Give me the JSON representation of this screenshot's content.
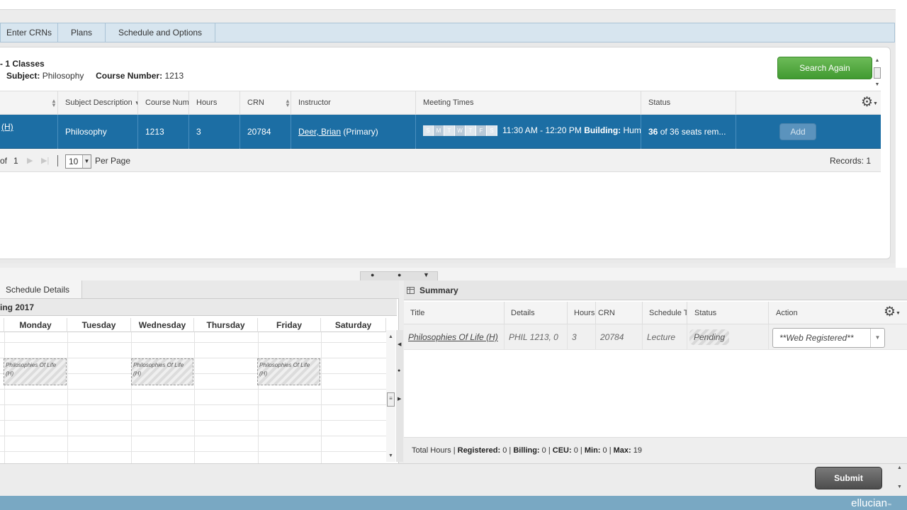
{
  "tabs": [
    {
      "label": "Enter CRNs"
    },
    {
      "label": "Plans"
    },
    {
      "label": "Schedule and Options"
    }
  ],
  "results": {
    "title": "- 1 Classes",
    "subject_label": "Subject:",
    "subject_value": "Philosophy",
    "course_number_label": "Course Number:",
    "course_number_value": "1213",
    "search_again": "Search Again",
    "columns": [
      "Subject Description",
      "Course Number",
      "Hours",
      "CRN",
      "Instructor",
      "Meeting Times",
      "Status"
    ],
    "row": {
      "title_fragment": "(H)",
      "subject": "Philosophy",
      "course_number": "1213",
      "hours": "3",
      "crn": "20784",
      "instructor_name": "Deer, Brian",
      "instructor_role": "(Primary)",
      "days": [
        "S",
        "M",
        "T",
        "W",
        "T",
        "F",
        "S"
      ],
      "meeting_time": "11:30 AM - 12:20 PM",
      "building_label": "Building:",
      "building_value": "Hum",
      "status_count": "36",
      "status_text": "of 36 seats rem...",
      "add_label": "Add"
    },
    "pager": {
      "of_label": "of",
      "total_pages": "1",
      "per_page_value": "10",
      "per_page_label": "Per Page",
      "records": "Records: 1"
    }
  },
  "schedule": {
    "tab_label": "Schedule Details",
    "term": "ing 2017",
    "days": [
      "Monday",
      "Tuesday",
      "Wednesday",
      "Thursday",
      "Friday",
      "Saturday"
    ],
    "event_label": "Philosophies Of Life (H)"
  },
  "summary": {
    "title": "Summary",
    "columns": [
      "Title",
      "Details",
      "Hours",
      "CRN",
      "Schedule Type",
      "Status",
      "Action"
    ],
    "row": {
      "title": "Philosophies Of Life (H)",
      "details": "PHIL 1213, 0",
      "hours": "3",
      "crn": "20784",
      "schedule_type": "Lecture",
      "status": "Pending",
      "action": "**Web Registered**"
    },
    "footer": {
      "total_hours_label": "Total Hours |",
      "registered_label": "Registered:",
      "registered_value": "0",
      "billing_label": "Billing:",
      "billing_value": "0",
      "ceu_label": "CEU:",
      "ceu_value": "0",
      "min_label": "Min:",
      "min_value": "0",
      "max_label": "Max:",
      "max_value": "19"
    }
  },
  "submit_label": "Submit",
  "brand": "ellucian"
}
